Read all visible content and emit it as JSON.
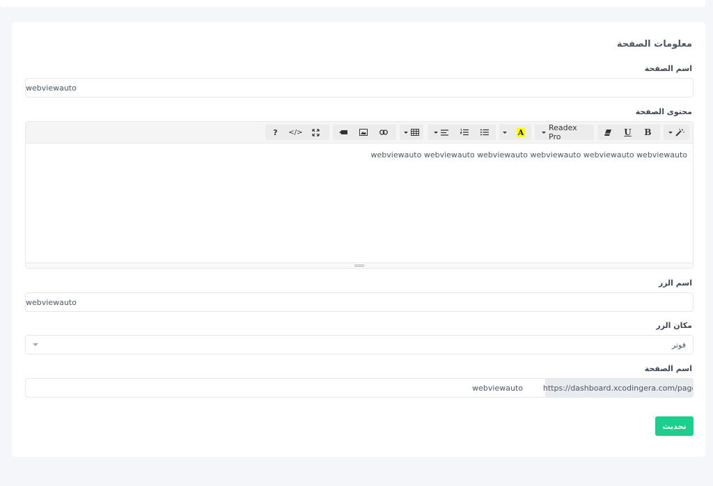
{
  "form": {
    "section_title": "معلومات الصفحة",
    "page_name_label": "اسم الصفحة",
    "page_name_value": "webviewauto",
    "content_label": "محتوى الصفحة",
    "content_text": "webviewauto webviewauto webviewauto webviewauto webviewauto webviewauto",
    "button_name_label": "اسم الزر",
    "button_name_value": "webviewauto",
    "button_location_label": "مكان الزر",
    "button_location_value": "فوتر",
    "slug_label": "اسم الصفحة",
    "slug_prefix": "https://dashboard.xcodingera.com/page/",
    "slug_value": "webviewauto",
    "submit_label": "تحديث"
  },
  "toolbar": {
    "font_name": "Readex Pro",
    "help_label": "?",
    "code_label": "</>",
    "bold_label": "B",
    "underline_label": "U",
    "highlight_label": "A",
    "highlight_color": "#ffff00",
    "icons": [
      "magic-icon",
      "bold-icon",
      "underline-icon",
      "eraser-icon",
      "font-family-dropdown",
      "text-color-icon",
      "color-dropdown",
      "unordered-list-icon",
      "ordered-list-icon",
      "paragraph-align-icon",
      "table-icon",
      "link-icon",
      "image-icon",
      "video-icon",
      "fullscreen-icon",
      "code-view-icon",
      "help-icon"
    ]
  },
  "colors": {
    "accent": "#1ccf8e",
    "background": "#f4f6fa"
  }
}
